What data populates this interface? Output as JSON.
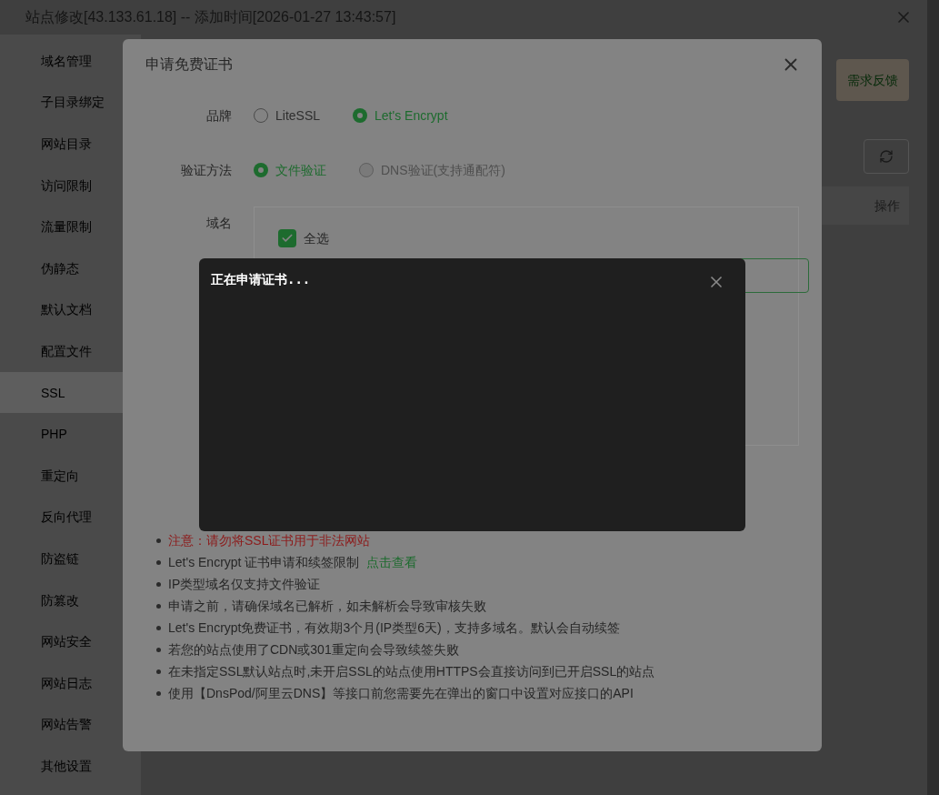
{
  "window": {
    "title": "站点修改[43.133.61.18] -- 添加时间[2026-01-27 13:43:57]"
  },
  "sidebar": {
    "items": [
      {
        "label": "域名管理",
        "selected": false
      },
      {
        "label": "子目录绑定",
        "selected": false
      },
      {
        "label": "网站目录",
        "selected": false
      },
      {
        "label": "访问限制",
        "selected": false
      },
      {
        "label": "流量限制",
        "selected": false
      },
      {
        "label": "伪静态",
        "selected": false
      },
      {
        "label": "默认文档",
        "selected": false
      },
      {
        "label": "配置文件",
        "selected": false
      },
      {
        "label": "SSL",
        "selected": true
      },
      {
        "label": "PHP",
        "selected": false
      },
      {
        "label": "重定向",
        "selected": false
      },
      {
        "label": "反向代理",
        "selected": false
      },
      {
        "label": "防盗链",
        "selected": false
      },
      {
        "label": "防篡改",
        "selected": false
      },
      {
        "label": "网站安全",
        "selected": false
      },
      {
        "label": "网站日志",
        "selected": false
      },
      {
        "label": "网站告警",
        "selected": false
      },
      {
        "label": "其他设置",
        "selected": false
      }
    ]
  },
  "main": {
    "feedback_link": "需求反馈",
    "table": {
      "columns": [
        "操作"
      ]
    }
  },
  "dialog": {
    "title": "申请免费证书",
    "brand": {
      "label": "品牌",
      "options": [
        {
          "label": "LiteSSL",
          "selected": false,
          "disabled": false
        },
        {
          "label": "Let's Encrypt",
          "selected": true,
          "disabled": false
        }
      ]
    },
    "verify_method": {
      "label": "验证方法",
      "options": [
        {
          "label": "文件验证",
          "selected": true,
          "disabled": false
        },
        {
          "label": "DNS验证(支持通配符)",
          "selected": false,
          "disabled": true
        }
      ]
    },
    "domain": {
      "label": "域名",
      "select_all": {
        "label": "全选",
        "checked": true
      }
    },
    "notes": [
      {
        "kind": "warning",
        "text": "注意：请勿将SSL证书用于非法网站"
      },
      {
        "kind": "link",
        "text": "Let's Encrypt 证书申请和续签限制",
        "link": "点击查看"
      },
      {
        "kind": "plain",
        "text": "IP类型域名仅支持文件验证"
      },
      {
        "kind": "plain",
        "text": "申请之前，请确保域名已解析，如未解析会导致审核失败"
      },
      {
        "kind": "plain",
        "text": "Let's Encrypt免费证书，有效期3个月(IP类型6天)，支持多域名。默认会自动续签"
      },
      {
        "kind": "plain",
        "text": "若您的站点使用了CDN或301重定向会导致续签失败"
      },
      {
        "kind": "plain",
        "text": "在未指定SSL默认站点时,未开启SSL的站点使用HTTPS会直接访问到已开启SSL的站点"
      },
      {
        "kind": "plain",
        "text": "使用【DnsPod/阿里云DNS】等接口前您需要先在弹出的窗口中设置对应接口的API"
      }
    ]
  },
  "progress_popup": {
    "message": "正在申请证书..."
  }
}
